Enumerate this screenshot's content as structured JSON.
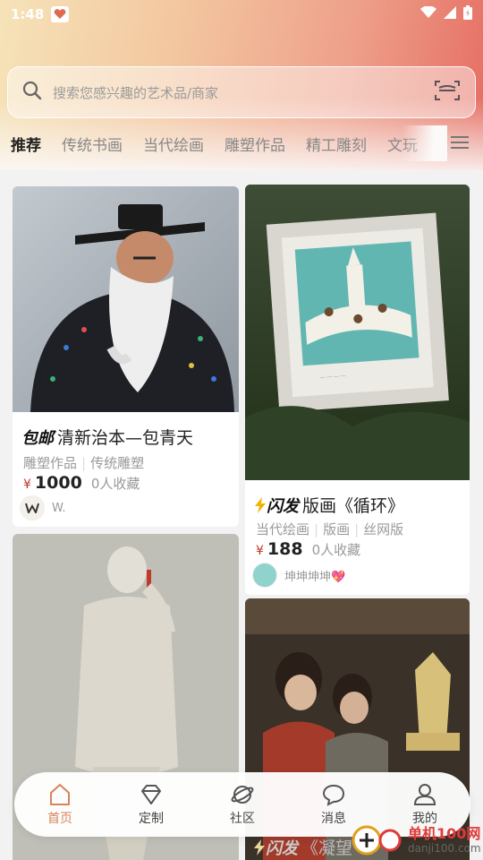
{
  "status_bar": {
    "time": "1:48"
  },
  "search": {
    "placeholder": "搜索您感兴趣的艺术品/商家"
  },
  "tabs": [
    {
      "label": "推荐",
      "active": true
    },
    {
      "label": "传统书画"
    },
    {
      "label": "当代绘画"
    },
    {
      "label": "雕塑作品"
    },
    {
      "label": "精工雕刻"
    },
    {
      "label": "文玩"
    }
  ],
  "cards": [
    {
      "badge": "包邮",
      "title": "清新治本—包青天",
      "tags": [
        "雕塑作品",
        "传统雕塑"
      ],
      "price_symbol": "¥",
      "price": "1000",
      "favorites": "0人收藏",
      "seller": "W."
    },
    {
      "badge": "闪发",
      "title": "版画《循环》",
      "tags": [
        "当代绘画",
        "版画",
        "丝网版"
      ],
      "price_symbol": "¥",
      "price": "188",
      "favorites": "0人收藏",
      "seller": "坤坤坤坤💖"
    },
    {
      "badge": "闪发",
      "title": "《凝望"
    }
  ],
  "bottom_nav": [
    {
      "label": "首页",
      "icon": "home-icon",
      "active": true
    },
    {
      "label": "定制",
      "icon": "diamond-icon"
    },
    {
      "label": "社区",
      "icon": "planet-icon"
    },
    {
      "label": "消息",
      "icon": "chat-icon"
    },
    {
      "label": "我的",
      "icon": "user-icon"
    }
  ],
  "watermark": {
    "name": "单机100网",
    "url": "danji100.com"
  },
  "colors": {
    "accent": "#d9835a",
    "price": "#c0392b"
  }
}
